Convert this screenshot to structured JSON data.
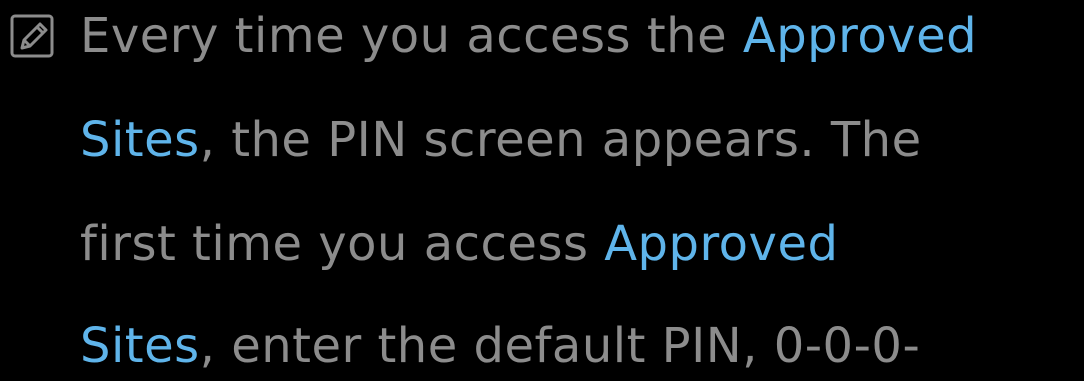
{
  "note": {
    "icon": "note-pencil-icon",
    "colors": {
      "text": "#8c8c8c",
      "highlight": "#5fb4ea",
      "background": "#000000"
    },
    "lines": [
      [
        {
          "text": "Every time you access the ",
          "highlight": false
        },
        {
          "text": "Approved",
          "highlight": true
        }
      ],
      [
        {
          "text": "Sites",
          "highlight": true
        },
        {
          "text": ", the PIN screen appears. The",
          "highlight": false
        }
      ],
      [
        {
          "text": "first time you access ",
          "highlight": false
        },
        {
          "text": "Approved",
          "highlight": true
        }
      ],
      [
        {
          "text": "Sites",
          "highlight": true
        },
        {
          "text": ", enter the default PIN, 0-0-0-",
          "highlight": false
        }
      ]
    ]
  }
}
